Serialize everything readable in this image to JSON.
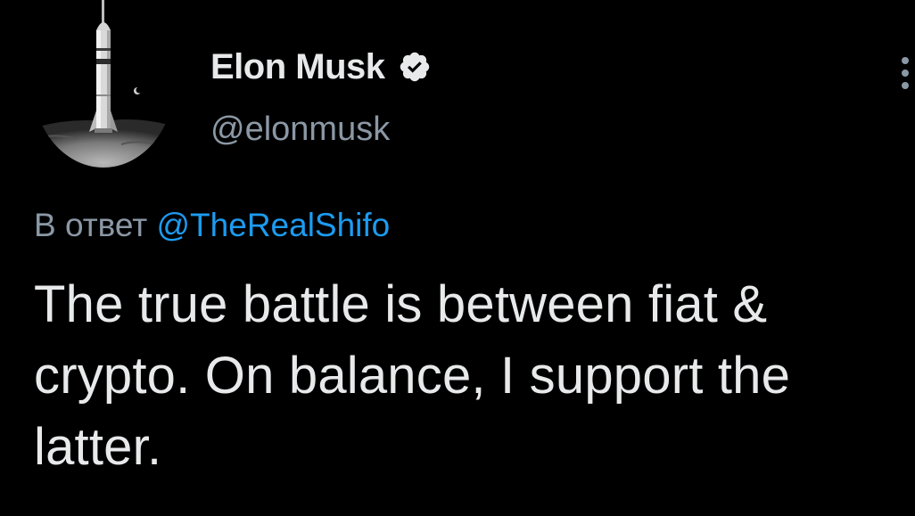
{
  "tweet": {
    "author": {
      "display_name": "Elon Musk",
      "handle": "@elonmusk",
      "verified": true,
      "avatar_icon": "starship-on-moon-avatar"
    },
    "reply_prefix": "В ответ",
    "reply_to": "@TheRealShifo",
    "text": "The true battle is between fiat & crypto. On balance, I support the latter.",
    "more_icon": "more-vertical-icon"
  },
  "colors": {
    "background": "#000000",
    "primary_text": "#e7e9ea",
    "secondary_text": "#8b98a5",
    "link": "#1d9bf0",
    "verified_badge": "#e7e9ea"
  }
}
